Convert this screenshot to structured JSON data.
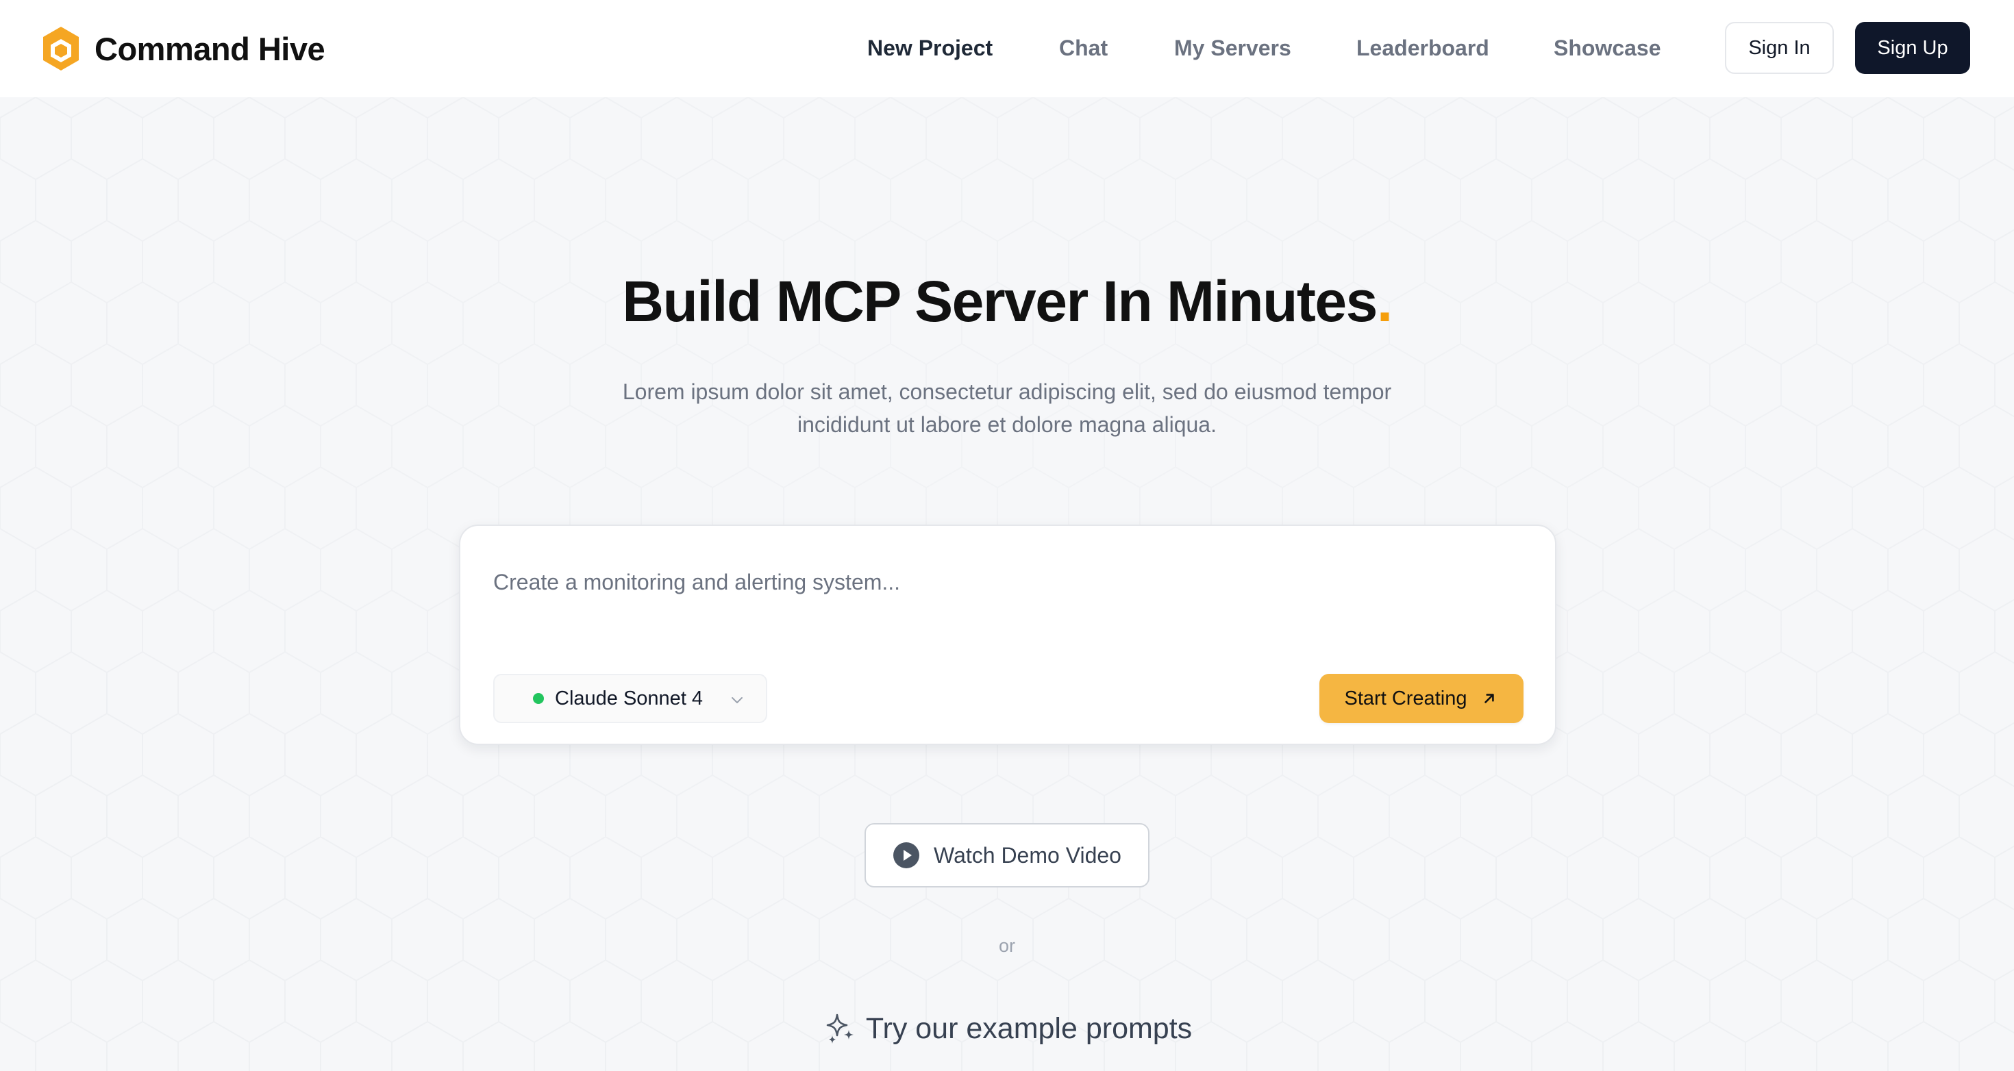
{
  "brand": {
    "name": "Command Hive",
    "logo_icon": "hexagon-logo-icon",
    "accent": "#f5a623"
  },
  "nav": {
    "items": [
      {
        "label": "New Project",
        "active": true
      },
      {
        "label": "Chat",
        "active": false
      },
      {
        "label": "My Servers",
        "active": false
      },
      {
        "label": "Leaderboard",
        "active": false
      },
      {
        "label": "Showcase",
        "active": false
      }
    ],
    "sign_in": "Sign In",
    "sign_up": "Sign Up"
  },
  "hero": {
    "title": "Build MCP Server In Minutes",
    "title_punct": ".",
    "title_punct_color": "#f59e0b",
    "subtitle_line1": "Lorem ipsum dolor sit amet, consectetur adipiscing elit, sed do eiusmod tempor",
    "subtitle_line2": "incididunt ut labore et dolore magna aliqua."
  },
  "prompt": {
    "placeholder": "Create a monitoring and alerting system...",
    "value": "",
    "model": {
      "label": "Claude Sonnet 4",
      "status_color": "#22c55e",
      "icon": "chevron-down-icon"
    },
    "start_label": "Start Creating",
    "start_icon": "arrow-up-right-icon",
    "start_color": "#f5b642"
  },
  "demo": {
    "label": "Watch Demo Video",
    "icon": "play-circle-icon"
  },
  "or_text": "or",
  "examples": {
    "label": "Try our example prompts",
    "icon": "sparkles-icon"
  },
  "colors": {
    "background": "#f6f7f9",
    "primary_dark": "#0f172a"
  }
}
